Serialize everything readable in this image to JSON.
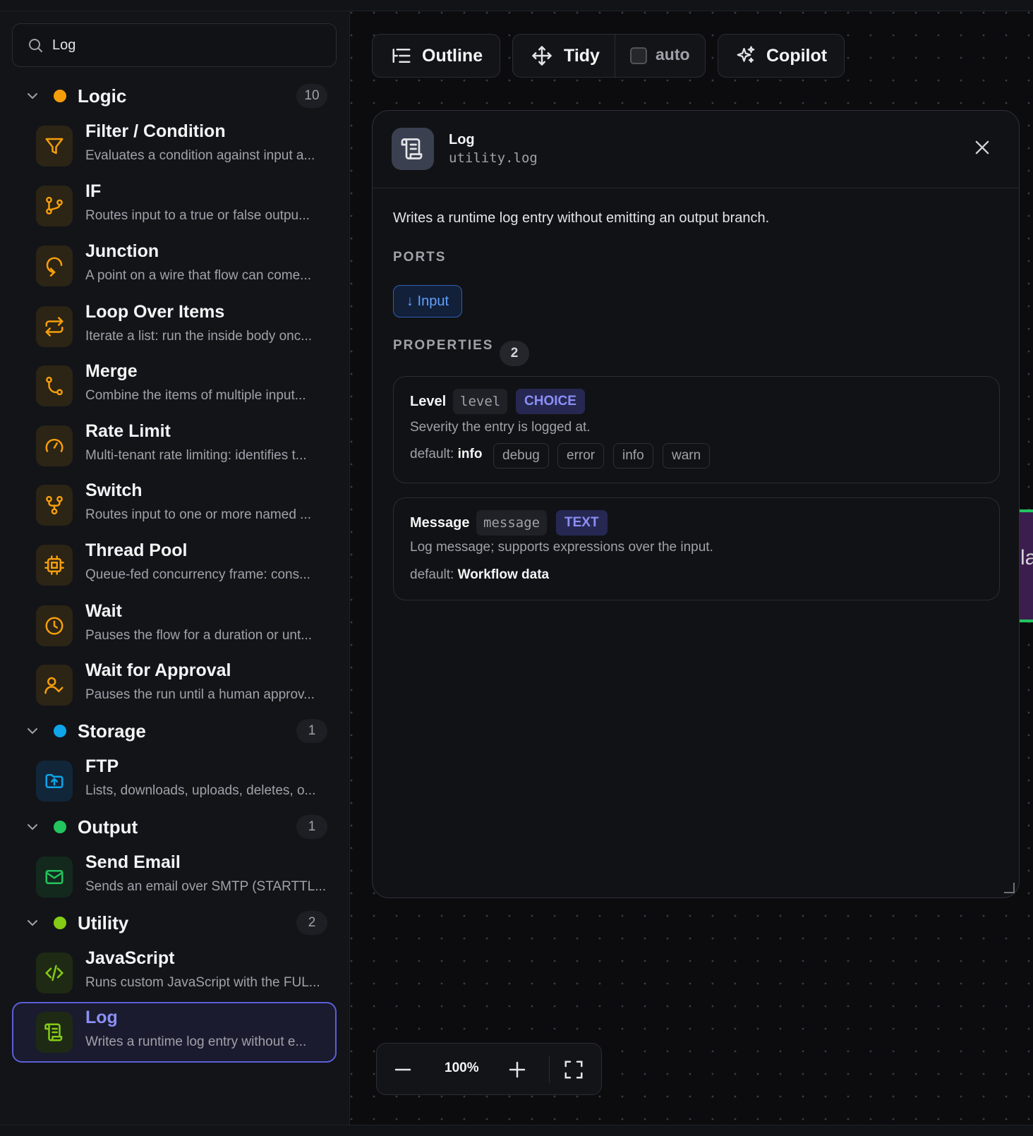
{
  "search": {
    "value": "Log",
    "icon": "search-icon"
  },
  "groups": [
    {
      "name": "Logic",
      "count": "10",
      "color": "#f59e0b"
    },
    {
      "name": "Storage",
      "count": "1",
      "color": "#0ea5e9"
    },
    {
      "name": "Output",
      "count": "1",
      "color": "#22c55e"
    },
    {
      "name": "Utility",
      "count": "2",
      "color": "#84cc16"
    }
  ],
  "items": [
    {
      "name": "Filter / Condition",
      "desc": "Evaluates a condition against input a...",
      "icon": "filter-icon"
    },
    {
      "name": "IF",
      "desc": "Routes input to a true or false outpu...",
      "icon": "branch-icon"
    },
    {
      "name": "Junction",
      "desc": "A point on a wire that flow can come...",
      "icon": "junction-icon"
    },
    {
      "name": "Loop Over Items",
      "desc": "Iterate a list: run the inside body onc...",
      "icon": "loop-icon"
    },
    {
      "name": "Merge",
      "desc": "Combine the items of multiple input...",
      "icon": "merge-icon"
    },
    {
      "name": "Rate Limit",
      "desc": "Multi-tenant rate limiting: identifies t...",
      "icon": "gauge-icon"
    },
    {
      "name": "Switch",
      "desc": "Routes input to one or more named ...",
      "icon": "switch-icon"
    },
    {
      "name": "Thread Pool",
      "desc": "Queue-fed concurrency frame: cons...",
      "icon": "cpu-icon"
    },
    {
      "name": "Wait",
      "desc": "Pauses the flow for a duration or unt...",
      "icon": "clock-icon"
    },
    {
      "name": "Wait for Approval",
      "desc": "Pauses the run until a human approv...",
      "icon": "user-check-icon"
    },
    {
      "name": "FTP",
      "desc": "Lists, downloads, uploads, deletes, o...",
      "icon": "folder-upload-icon"
    },
    {
      "name": "Send Email",
      "desc": "Sends an email over SMTP (STARTTL...",
      "icon": "mail-icon"
    },
    {
      "name": "JavaScript",
      "desc": "Runs custom JavaScript with the FUL...",
      "icon": "code-icon"
    },
    {
      "name": "Log",
      "desc": "Writes a runtime log entry without e...",
      "icon": "scroll-icon"
    }
  ],
  "toolbar": {
    "outline": "Outline",
    "tidy": "Tidy",
    "auto": "auto",
    "copilot": "Copilot"
  },
  "panel": {
    "title": "Log",
    "slug": "utility.log",
    "description": "Writes a runtime log entry without emitting an output branch.",
    "ports_label": "PORTS",
    "port": "↓ Input",
    "properties_label": "PROPERTIES",
    "properties_count": "2",
    "properties": [
      {
        "label": "Level",
        "key": "level",
        "type": "CHOICE",
        "description": "Severity the entry is logged at.",
        "default_label": "default:",
        "default_value": "info",
        "options": [
          "debug",
          "error",
          "info",
          "warn"
        ]
      },
      {
        "label": "Message",
        "key": "message",
        "type": "TEXT",
        "description": "Log message; supports expressions over the input.",
        "default_label": "default:",
        "default_value": "Workflow data"
      }
    ]
  },
  "zoom": {
    "value": "100%"
  },
  "canvas_edge_text": "la"
}
